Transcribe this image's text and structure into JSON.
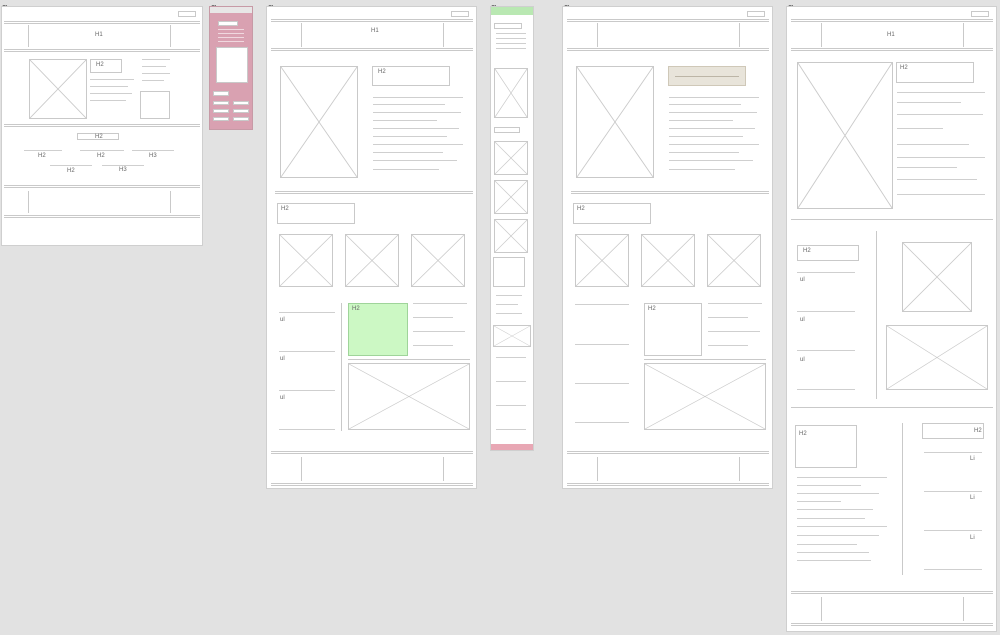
{
  "canvas": {
    "background": "#e2e2e2"
  },
  "board_menu_icon": "...",
  "labels": {
    "h1": "H1",
    "h2": "H2",
    "h3": "H3",
    "ul": "ul",
    "li": "Li"
  },
  "colors": {
    "mobile_pink": "#d9a1b1",
    "mobile_green": "#b9e8b2",
    "highlight_green": "#ccf8c4",
    "highlight_beige": "#e8e4da"
  }
}
